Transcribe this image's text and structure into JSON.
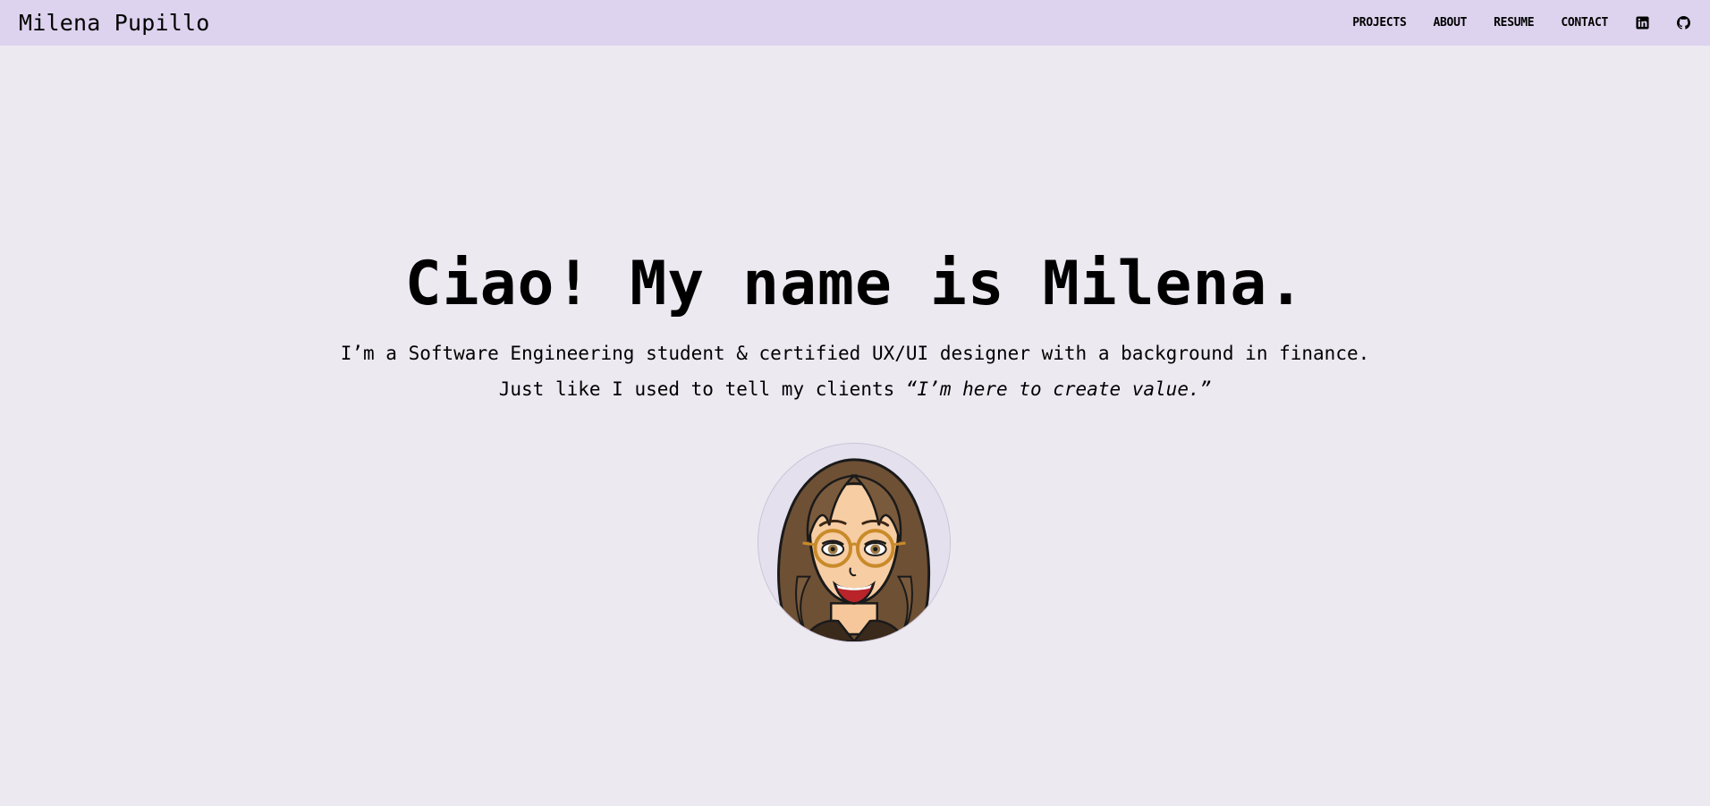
{
  "navbar": {
    "brand": "Milena Pupillo",
    "links": [
      {
        "label": "PROJECTS"
      },
      {
        "label": "ABOUT"
      },
      {
        "label": "RESUME"
      },
      {
        "label": "CONTACT"
      }
    ],
    "icons": [
      "linkedin-icon",
      "github-icon"
    ]
  },
  "hero": {
    "title": "Ciao! My name is Milena.",
    "line1": "I’m a Software Engineering student & certified UX/UI designer with a background in finance.",
    "line2_prefix": "Just like I used to tell my clients ",
    "line2_quote": "“I’m here to create value.”"
  },
  "colors": {
    "page_background": "#ECE9F1",
    "navbar_background": "#DDD3EE",
    "text": "#000000"
  }
}
